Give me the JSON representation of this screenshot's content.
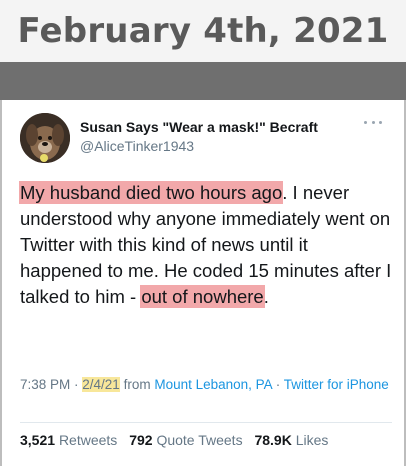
{
  "header": {
    "date": "February 4th, 2021"
  },
  "tweet": {
    "author": {
      "name": "Susan Says \"Wear a mask!\" Becraft",
      "handle": "@AliceTinker1943",
      "avatar_icon": "dog-avatar-icon"
    },
    "more_icon": "more-options-icon",
    "text": {
      "highlight_1": "My husband died two hours ago",
      "part_1": ". I never understood why anyone immediately went on Twitter with this kind of news until it happened to me. He coded 15 minutes after I talked to him - ",
      "highlight_2": "out of nowhere",
      "part_2": "."
    },
    "meta": {
      "time": "7:38 PM",
      "sep1": " · ",
      "date": "2/4/21",
      "from_text": " from ",
      "location": "Mount Lebanon, PA",
      "sep2": " · ",
      "source": "Twitter for iPhone"
    },
    "stats": {
      "retweets_count": "3,521",
      "retweets_label": "Retweets",
      "quotes_count": "792",
      "quotes_label": "Quote Tweets",
      "likes_count": "78.9K",
      "likes_label": "Likes"
    }
  },
  "colors": {
    "highlight_pink": "#f2a8aa",
    "highlight_yellow": "#f8e79a",
    "link_blue": "#1b95e0",
    "band_gray": "#6f6f6f"
  }
}
